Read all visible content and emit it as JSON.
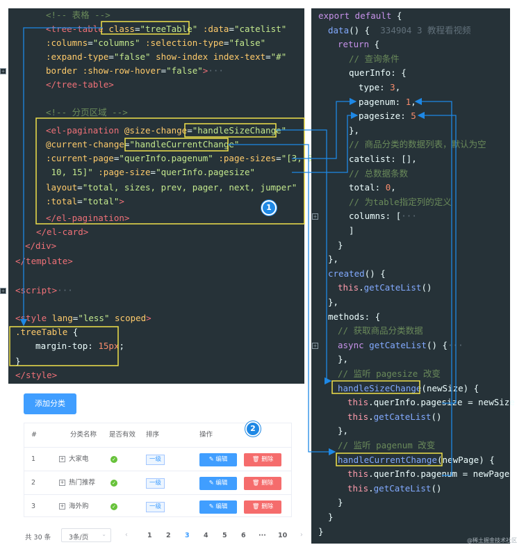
{
  "left_code": {
    "lines": [
      {
        "segments": [
          {
            "c": "cmt",
            "t": "<!-- 表格 -->"
          }
        ]
      },
      {
        "segments": [
          {
            "c": "tag",
            "t": "<tree-table"
          },
          {
            "c": "vr",
            "t": " "
          },
          {
            "c": "atn",
            "t": "class"
          },
          {
            "c": "vr",
            "t": "="
          },
          {
            "c": "str",
            "t": "\"treeTable\""
          },
          {
            "c": "vr",
            "t": " "
          },
          {
            "c": "atn",
            "t": ":data"
          },
          {
            "c": "vr",
            "t": "="
          },
          {
            "c": "str",
            "t": "\"catelist\""
          }
        ]
      },
      {
        "segments": [
          {
            "c": "atn",
            "t": ":columns"
          },
          {
            "c": "vr",
            "t": "="
          },
          {
            "c": "str",
            "t": "\"columns\""
          },
          {
            "c": "vr",
            "t": " "
          },
          {
            "c": "atn",
            "t": ":selection-type"
          },
          {
            "c": "vr",
            "t": "="
          },
          {
            "c": "str",
            "t": "\"false\""
          }
        ]
      },
      {
        "segments": [
          {
            "c": "atn",
            "t": ":expand-type"
          },
          {
            "c": "vr",
            "t": "="
          },
          {
            "c": "str",
            "t": "\"false\""
          },
          {
            "c": "vr",
            "t": " "
          },
          {
            "c": "atn",
            "t": "show-index"
          },
          {
            "c": "vr",
            "t": " "
          },
          {
            "c": "atn",
            "t": "index-text"
          },
          {
            "c": "vr",
            "t": "="
          },
          {
            "c": "str",
            "t": "\"#\""
          }
        ]
      },
      {
        "segments": [
          {
            "c": "atn",
            "t": "border"
          },
          {
            "c": "vr",
            "t": " "
          },
          {
            "c": "atn",
            "t": ":show-row-hover"
          },
          {
            "c": "vr",
            "t": "="
          },
          {
            "c": "str",
            "t": "\"false\""
          },
          {
            "c": "tag",
            "t": ">"
          },
          {
            "c": "wm",
            "t": "···"
          }
        ]
      },
      {
        "segments": [
          {
            "c": "tag",
            "t": "</tree-table>"
          }
        ]
      },
      {
        "segments": []
      },
      {
        "segments": [
          {
            "c": "cmt",
            "t": "<!-- 分页区域 -->"
          }
        ]
      },
      {
        "segments": [
          {
            "c": "tag",
            "t": "<el-pagination"
          },
          {
            "c": "vr",
            "t": " "
          },
          {
            "c": "atn",
            "t": "@size-change"
          },
          {
            "c": "vr",
            "t": "="
          },
          {
            "c": "str",
            "t": "\"handleSizeChange\""
          }
        ]
      },
      {
        "segments": [
          {
            "c": "atn",
            "t": "@current-change"
          },
          {
            "c": "vr",
            "t": "="
          },
          {
            "c": "str",
            "t": "\"handleCurrentChange\""
          }
        ]
      },
      {
        "segments": [
          {
            "c": "atn",
            "t": ":current-page"
          },
          {
            "c": "vr",
            "t": "="
          },
          {
            "c": "str",
            "t": "\"querInfo.pagenum\""
          },
          {
            "c": "vr",
            "t": " "
          },
          {
            "c": "atn",
            "t": ":page-sizes"
          },
          {
            "c": "vr",
            "t": "="
          },
          {
            "c": "str",
            "t": "\"[3, 5,"
          }
        ]
      },
      {
        "segments": [
          {
            "c": "str",
            "t": " 10, 15]\""
          },
          {
            "c": "vr",
            "t": " "
          },
          {
            "c": "atn",
            "t": ":page-size"
          },
          {
            "c": "vr",
            "t": "="
          },
          {
            "c": "str",
            "t": "\"querInfo.pagesize\""
          }
        ]
      },
      {
        "segments": [
          {
            "c": "atn",
            "t": "layout"
          },
          {
            "c": "vr",
            "t": "="
          },
          {
            "c": "str",
            "t": "\"total, sizes, prev, pager, next, jumper\""
          }
        ]
      },
      {
        "segments": [
          {
            "c": "atn",
            "t": ":total"
          },
          {
            "c": "vr",
            "t": "="
          },
          {
            "c": "str",
            "t": "\"total\""
          },
          {
            "c": "tag",
            "t": ">"
          }
        ]
      },
      {
        "segments": [
          {
            "c": "tag",
            "t": "</el-pagination>"
          }
        ]
      },
      {
        "segments": [
          {
            "c": "tag",
            "t": "</el-card>"
          }
        ]
      },
      {
        "segments": [
          {
            "c": "tag",
            "t": "</div>"
          }
        ]
      },
      {
        "segments": [
          {
            "c": "tag",
            "t": "</template>"
          }
        ]
      },
      {
        "segments": []
      },
      {
        "segments": [
          {
            "c": "tag",
            "t": "<script>"
          },
          {
            "c": "wm",
            "t": "···"
          }
        ]
      },
      {
        "segments": []
      },
      {
        "segments": [
          {
            "c": "tag",
            "t": "<style"
          },
          {
            "c": "vr",
            "t": " "
          },
          {
            "c": "atn",
            "t": "lang"
          },
          {
            "c": "vr",
            "t": "="
          },
          {
            "c": "str",
            "t": "\"less\""
          },
          {
            "c": "vr",
            "t": " "
          },
          {
            "c": "atn",
            "t": "scoped"
          },
          {
            "c": "tag",
            "t": ">"
          }
        ]
      },
      {
        "segments": [
          {
            "c": "atn",
            "t": ".treeTable"
          },
          {
            "c": "vr",
            "t": " {"
          }
        ]
      },
      {
        "segments": [
          {
            "c": "vr",
            "t": "  margin-top: "
          },
          {
            "c": "num",
            "t": "15px"
          },
          {
            "c": "vr",
            "t": ";"
          }
        ]
      },
      {
        "segments": [
          {
            "c": "vr",
            "t": "}"
          }
        ]
      },
      {
        "segments": [
          {
            "c": "tag",
            "t": "</style>"
          }
        ]
      }
    ]
  },
  "right_code": {
    "lines": [
      {
        "segments": [
          {
            "c": "kw",
            "t": "export default"
          },
          {
            "c": "vr",
            "t": " {"
          }
        ]
      },
      {
        "segments": [
          {
            "c": "fn",
            "t": "data"
          },
          {
            "c": "vr",
            "t": "() {"
          },
          {
            "c": "wm",
            "t": "  334904 3 教程看视频"
          }
        ]
      },
      {
        "segments": [
          {
            "c": "kw",
            "t": "return"
          },
          {
            "c": "vr",
            "t": " {"
          }
        ]
      },
      {
        "segments": [
          {
            "c": "cmt",
            "t": "// 查询条件"
          }
        ]
      },
      {
        "segments": [
          {
            "c": "vr",
            "t": "querInfo: {"
          }
        ]
      },
      {
        "segments": [
          {
            "c": "vr",
            "t": "type: "
          },
          {
            "c": "num",
            "t": "3"
          },
          {
            "c": "vr",
            "t": ","
          }
        ]
      },
      {
        "segments": [
          {
            "c": "vr",
            "t": "pagenum: "
          },
          {
            "c": "num",
            "t": "1"
          },
          {
            "c": "vr",
            "t": ","
          }
        ]
      },
      {
        "segments": [
          {
            "c": "vr",
            "t": "pagesize: "
          },
          {
            "c": "num",
            "t": "5"
          }
        ]
      },
      {
        "segments": [
          {
            "c": "vr",
            "t": "},"
          }
        ]
      },
      {
        "segments": [
          {
            "c": "cmt",
            "t": "// 商品分类的数据列表，默认为空"
          }
        ]
      },
      {
        "segments": [
          {
            "c": "vr",
            "t": "catelist: [],"
          }
        ]
      },
      {
        "segments": [
          {
            "c": "cmt",
            "t": "// 总数据条数"
          }
        ]
      },
      {
        "segments": [
          {
            "c": "vr",
            "t": "total: "
          },
          {
            "c": "num",
            "t": "0"
          },
          {
            "c": "vr",
            "t": ","
          }
        ]
      },
      {
        "segments": [
          {
            "c": "cmt",
            "t": "// 为table指定列的定义"
          }
        ]
      },
      {
        "segments": [
          {
            "c": "vr",
            "t": "columns: ["
          },
          {
            "c": "wm",
            "t": "···"
          }
        ]
      },
      {
        "segments": [
          {
            "c": "vr",
            "t": "]"
          }
        ]
      },
      {
        "segments": [
          {
            "c": "vr",
            "t": "}"
          }
        ]
      },
      {
        "segments": [
          {
            "c": "vr",
            "t": "},"
          }
        ]
      },
      {
        "segments": [
          {
            "c": "fn",
            "t": "created"
          },
          {
            "c": "vr",
            "t": "() {"
          }
        ]
      },
      {
        "segments": [
          {
            "c": "this",
            "t": "this"
          },
          {
            "c": "vr",
            "t": "."
          },
          {
            "c": "fn",
            "t": "getCateList"
          },
          {
            "c": "vr",
            "t": "()"
          }
        ]
      },
      {
        "segments": [
          {
            "c": "vr",
            "t": "},"
          }
        ]
      },
      {
        "segments": [
          {
            "c": "vr",
            "t": "methods: {"
          }
        ]
      },
      {
        "segments": [
          {
            "c": "cmt",
            "t": "// 获取商品分类数据"
          }
        ]
      },
      {
        "segments": [
          {
            "c": "kw",
            "t": "async"
          },
          {
            "c": "vr",
            "t": " "
          },
          {
            "c": "fn",
            "t": "getCateList"
          },
          {
            "c": "vr",
            "t": "() {"
          },
          {
            "c": "wm",
            "t": "···"
          }
        ]
      },
      {
        "segments": [
          {
            "c": "vr",
            "t": "},"
          }
        ]
      },
      {
        "segments": [
          {
            "c": "cmt",
            "t": "// 监听 pagesize 改变"
          }
        ]
      },
      {
        "segments": [
          {
            "c": "fn",
            "t": "handleSizeChange"
          },
          {
            "c": "vr",
            "t": "(newSize) {"
          }
        ]
      },
      {
        "segments": [
          {
            "c": "this",
            "t": "this"
          },
          {
            "c": "vr",
            "t": ".querInfo.pagesize = newSize"
          }
        ]
      },
      {
        "segments": [
          {
            "c": "this",
            "t": "this"
          },
          {
            "c": "vr",
            "t": "."
          },
          {
            "c": "fn",
            "t": "getCateList"
          },
          {
            "c": "vr",
            "t": "()"
          }
        ]
      },
      {
        "segments": [
          {
            "c": "vr",
            "t": "},"
          }
        ]
      },
      {
        "segments": [
          {
            "c": "cmt",
            "t": "// 监听 pagenum 改变"
          }
        ]
      },
      {
        "segments": [
          {
            "c": "fn",
            "t": "handleCurrentChange"
          },
          {
            "c": "vr",
            "t": "(newPage) {"
          }
        ]
      },
      {
        "segments": [
          {
            "c": "this",
            "t": "this"
          },
          {
            "c": "vr",
            "t": ".querInfo.pagenum = newPage"
          }
        ]
      },
      {
        "segments": [
          {
            "c": "this",
            "t": "this"
          },
          {
            "c": "vr",
            "t": "."
          },
          {
            "c": "fn",
            "t": "getCateList"
          },
          {
            "c": "vr",
            "t": "()"
          }
        ]
      },
      {
        "segments": [
          {
            "c": "vr",
            "t": "}"
          }
        ]
      },
      {
        "segments": [
          {
            "c": "vr",
            "t": "}"
          }
        ]
      },
      {
        "segments": [
          {
            "c": "vr",
            "t": "}"
          }
        ]
      }
    ]
  },
  "web": {
    "add_button": "添加分类",
    "headers": [
      "#",
      "分类名称",
      "是否有效",
      "排序",
      "操作"
    ],
    "rows": [
      {
        "index": "1",
        "name": "大家电",
        "valid": "✓",
        "level": "一级",
        "edit": "编辑",
        "delete": "删除"
      },
      {
        "index": "2",
        "name": "热门推荐",
        "valid": "✓",
        "level": "一级",
        "edit": "编辑",
        "delete": "删除"
      },
      {
        "index": "3",
        "name": "海外购",
        "valid": "✓",
        "level": "一级",
        "edit": "编辑",
        "delete": "删除"
      }
    ],
    "pager": {
      "total": "共 30 条",
      "size": "3条/页",
      "pages": [
        "1",
        "2",
        "3",
        "4",
        "5",
        "6",
        "···",
        "10"
      ],
      "current": "3"
    }
  },
  "badges": [
    "1",
    "2"
  ],
  "watermark": "@稀土掘金技术社区",
  "colors": {
    "highlight": "#f0e14a",
    "arrow": "#1e88e5",
    "editor_bg": "#263238"
  }
}
